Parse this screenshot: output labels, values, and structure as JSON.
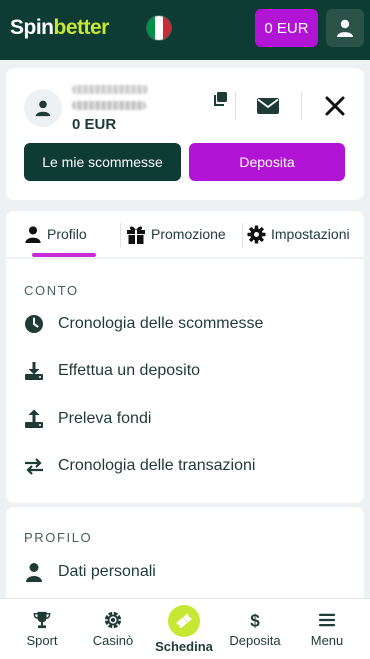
{
  "header": {
    "logo_part1": "Spin",
    "logo_part2": "better",
    "flag_icon": "italy-flag-icon",
    "balance_label": "0 EUR",
    "user_icon": "user-icon",
    "colors": {
      "background": "#0e3b33",
      "accent": "#b214d6",
      "logo_green": "#c6e832"
    }
  },
  "account": {
    "balance": "0 EUR",
    "my_bets_label": "Le mie scommesse",
    "deposit_label": "Deposita",
    "icons": [
      "copy-icon",
      "mail-icon",
      "close-icon"
    ]
  },
  "tabs": [
    {
      "label": "Profilo",
      "icon": "user-icon",
      "active": true
    },
    {
      "label": "Promozione",
      "icon": "gift-icon",
      "active": false
    },
    {
      "label": "Impostazioni",
      "icon": "gear-icon",
      "active": false
    }
  ],
  "sections": {
    "account_title": "CONTO",
    "account_items": [
      {
        "label": "Cronologia delle scommesse",
        "icon": "clock-icon"
      },
      {
        "label": "Effettua un deposito",
        "icon": "download-icon"
      },
      {
        "label": "Preleva fondi",
        "icon": "upload-icon"
      },
      {
        "label": "Cronologia delle transazioni",
        "icon": "transfer-arrows-icon"
      }
    ],
    "profile_title": "PROFILO",
    "profile_items": [
      {
        "label": "Dati personali",
        "icon": "user-icon"
      }
    ]
  },
  "bottom_nav": [
    {
      "label": "Sport",
      "icon": "trophy-icon"
    },
    {
      "label": "Casinò",
      "icon": "chip-icon"
    },
    {
      "label": "Schedina",
      "icon": "ticket-icon",
      "active": true
    },
    {
      "label": "Deposita",
      "icon": "dollar-icon"
    },
    {
      "label": "Menu",
      "icon": "hamburger-icon"
    }
  ]
}
